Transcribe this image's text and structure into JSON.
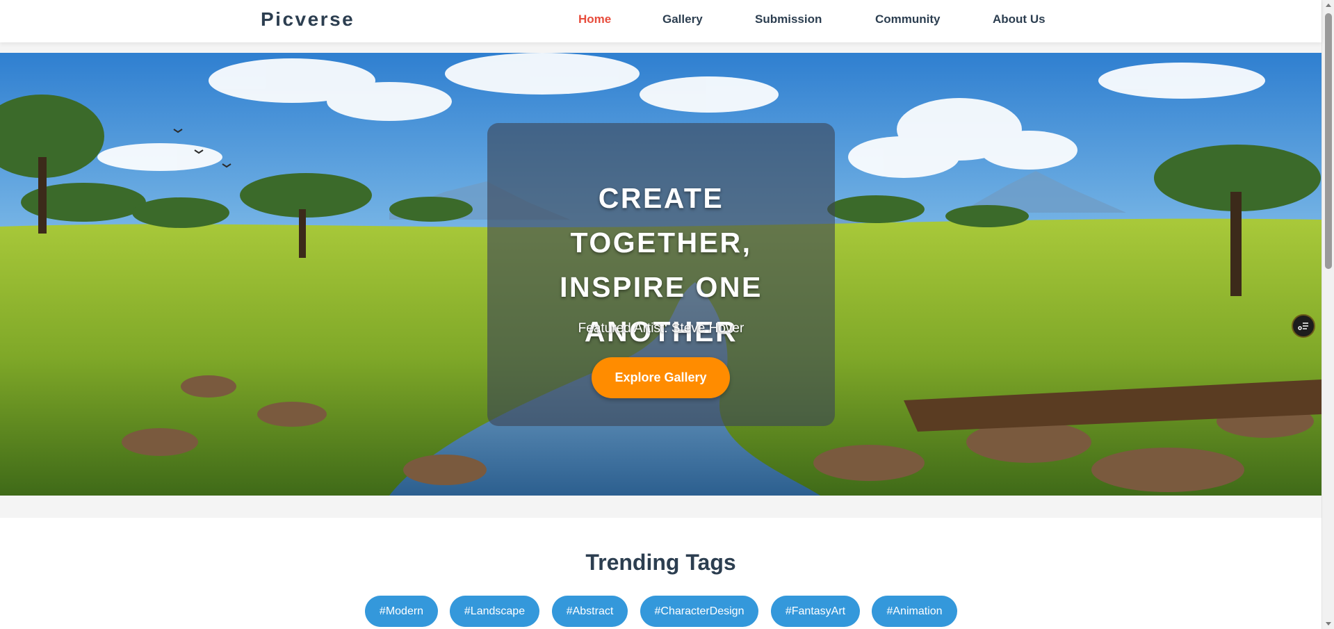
{
  "brand": {
    "name": "Picverse"
  },
  "nav": {
    "items": [
      {
        "label": "Home",
        "active": true
      },
      {
        "label": "Gallery",
        "active": false
      },
      {
        "label": "Submission",
        "active": false
      },
      {
        "label": "Community",
        "active": false
      },
      {
        "label": "About Us",
        "active": false
      }
    ]
  },
  "hero": {
    "title": "CREATE TOGETHER, INSPIRE ONE ANOTHER",
    "featured": "Featured Artist: Steve Hover",
    "cta_label": "Explore Gallery",
    "background_icon": "savanna-landscape-image"
  },
  "floating_button": {
    "icon": "settings-sliders-icon"
  },
  "trending": {
    "title": "Trending Tags",
    "tags": [
      "#Modern",
      "#Landscape",
      "#Abstract",
      "#CharacterDesign",
      "#FantasyArt",
      "#Animation"
    ]
  },
  "colors": {
    "brand_text": "#2c3e50",
    "nav_active": "#e74c3c",
    "cta": "#ff8c00",
    "tag": "#3498db"
  }
}
